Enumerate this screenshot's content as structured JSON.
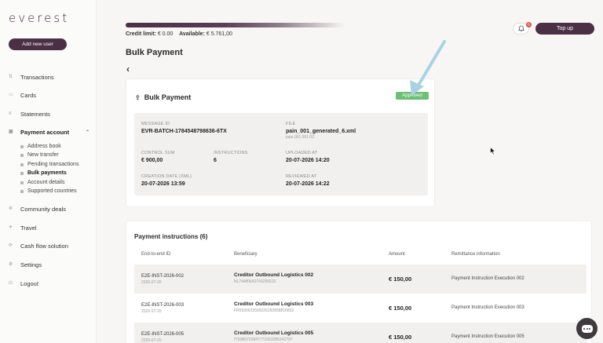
{
  "brand": {
    "logo": "everest",
    "add_user": "Add new user"
  },
  "sidebar": {
    "items": [
      {
        "label": "Transactions",
        "icon": "transactions-icon"
      },
      {
        "label": "Cards",
        "icon": "card-icon"
      },
      {
        "label": "Statements",
        "icon": "statements-icon"
      },
      {
        "label": "Payment account",
        "icon": "wallet-icon"
      },
      {
        "label": "Community deals",
        "icon": "community-icon"
      },
      {
        "label": "Travel",
        "icon": "travel-icon"
      },
      {
        "label": "Cash flow solution",
        "icon": "cashflow-icon"
      },
      {
        "label": "Settings",
        "icon": "gear-icon"
      },
      {
        "label": "Logout",
        "icon": "logout-icon"
      }
    ],
    "sub_items": [
      {
        "label": "Address book"
      },
      {
        "label": "New transfer"
      },
      {
        "label": "Pending transactions"
      },
      {
        "label": "Bulk payments"
      },
      {
        "label": "Account details"
      },
      {
        "label": "Supported countries"
      }
    ],
    "active_item": "Payment account",
    "active_sub_item": "Bulk payments"
  },
  "header": {
    "credit_limit_label": "Credit limit:",
    "credit_limit_value": "€ 0.00",
    "available_label": "Available:",
    "available_value": "€ 5.761,00",
    "notification_count": "6",
    "top_up": "Top up"
  },
  "page": {
    "title": "Bulk Payment"
  },
  "bulk": {
    "title": "Bulk Payment",
    "status": "Approved",
    "message_id_label": "MESSAGE ID",
    "message_id": "EVR-BATCH-1784548798636-6TX",
    "file_label": "FILE",
    "file_name": "pain_001_generated_6.xml",
    "file_type": "pain.001.001.03",
    "control_sum_label": "CONTROL SUM",
    "control_sum": "€ 900,00",
    "instructions_label": "INSTRUCTIONS",
    "instructions": "6",
    "uploaded_label": "UPLOADED AT",
    "uploaded": "20-07-2026 14:20",
    "creation_label": "CREATION DATE (XML)",
    "creation": "20-07-2026 13:59",
    "reviewed_label": "REVIEWED AT",
    "reviewed": "20-07-2026 14:22"
  },
  "instructions": {
    "title": "Payment instructions (6)",
    "columns": [
      "End-to-end ID",
      "Beneficiary",
      "Amount",
      "Remittance information"
    ],
    "rows": [
      {
        "id": "E2E-INST-2026-002",
        "date": "2026-07-20",
        "beneficiary": "Creditor Outbound Logistics 002",
        "iban": "NL74ABNA0743295532",
        "amount": "€ 150,00",
        "remittance": "Payment Instruction Execution 002"
      },
      {
        "id": "E2E-INST-2026-003",
        "date": "2026-07-20",
        "beneficiary": "Creditor Outbound Logistics 003",
        "iban": "FR5930023565026282858816833",
        "amount": "€ 150,00",
        "remittance": "Payment Instruction Execution 003"
      },
      {
        "id": "E2E-INST-2026-005",
        "date": "2026-07-20",
        "beneficiary": "Creditor Outbound Logistics 005",
        "iban": "IT59B0722847771653285242797",
        "amount": "€ 150,00",
        "remittance": "Payment Instruction Execution 005"
      }
    ]
  },
  "colors": {
    "brand": "#4a2f45",
    "approved": "#6dbe76",
    "badge": "#d9534f",
    "arrow": "#a9d3e3"
  }
}
